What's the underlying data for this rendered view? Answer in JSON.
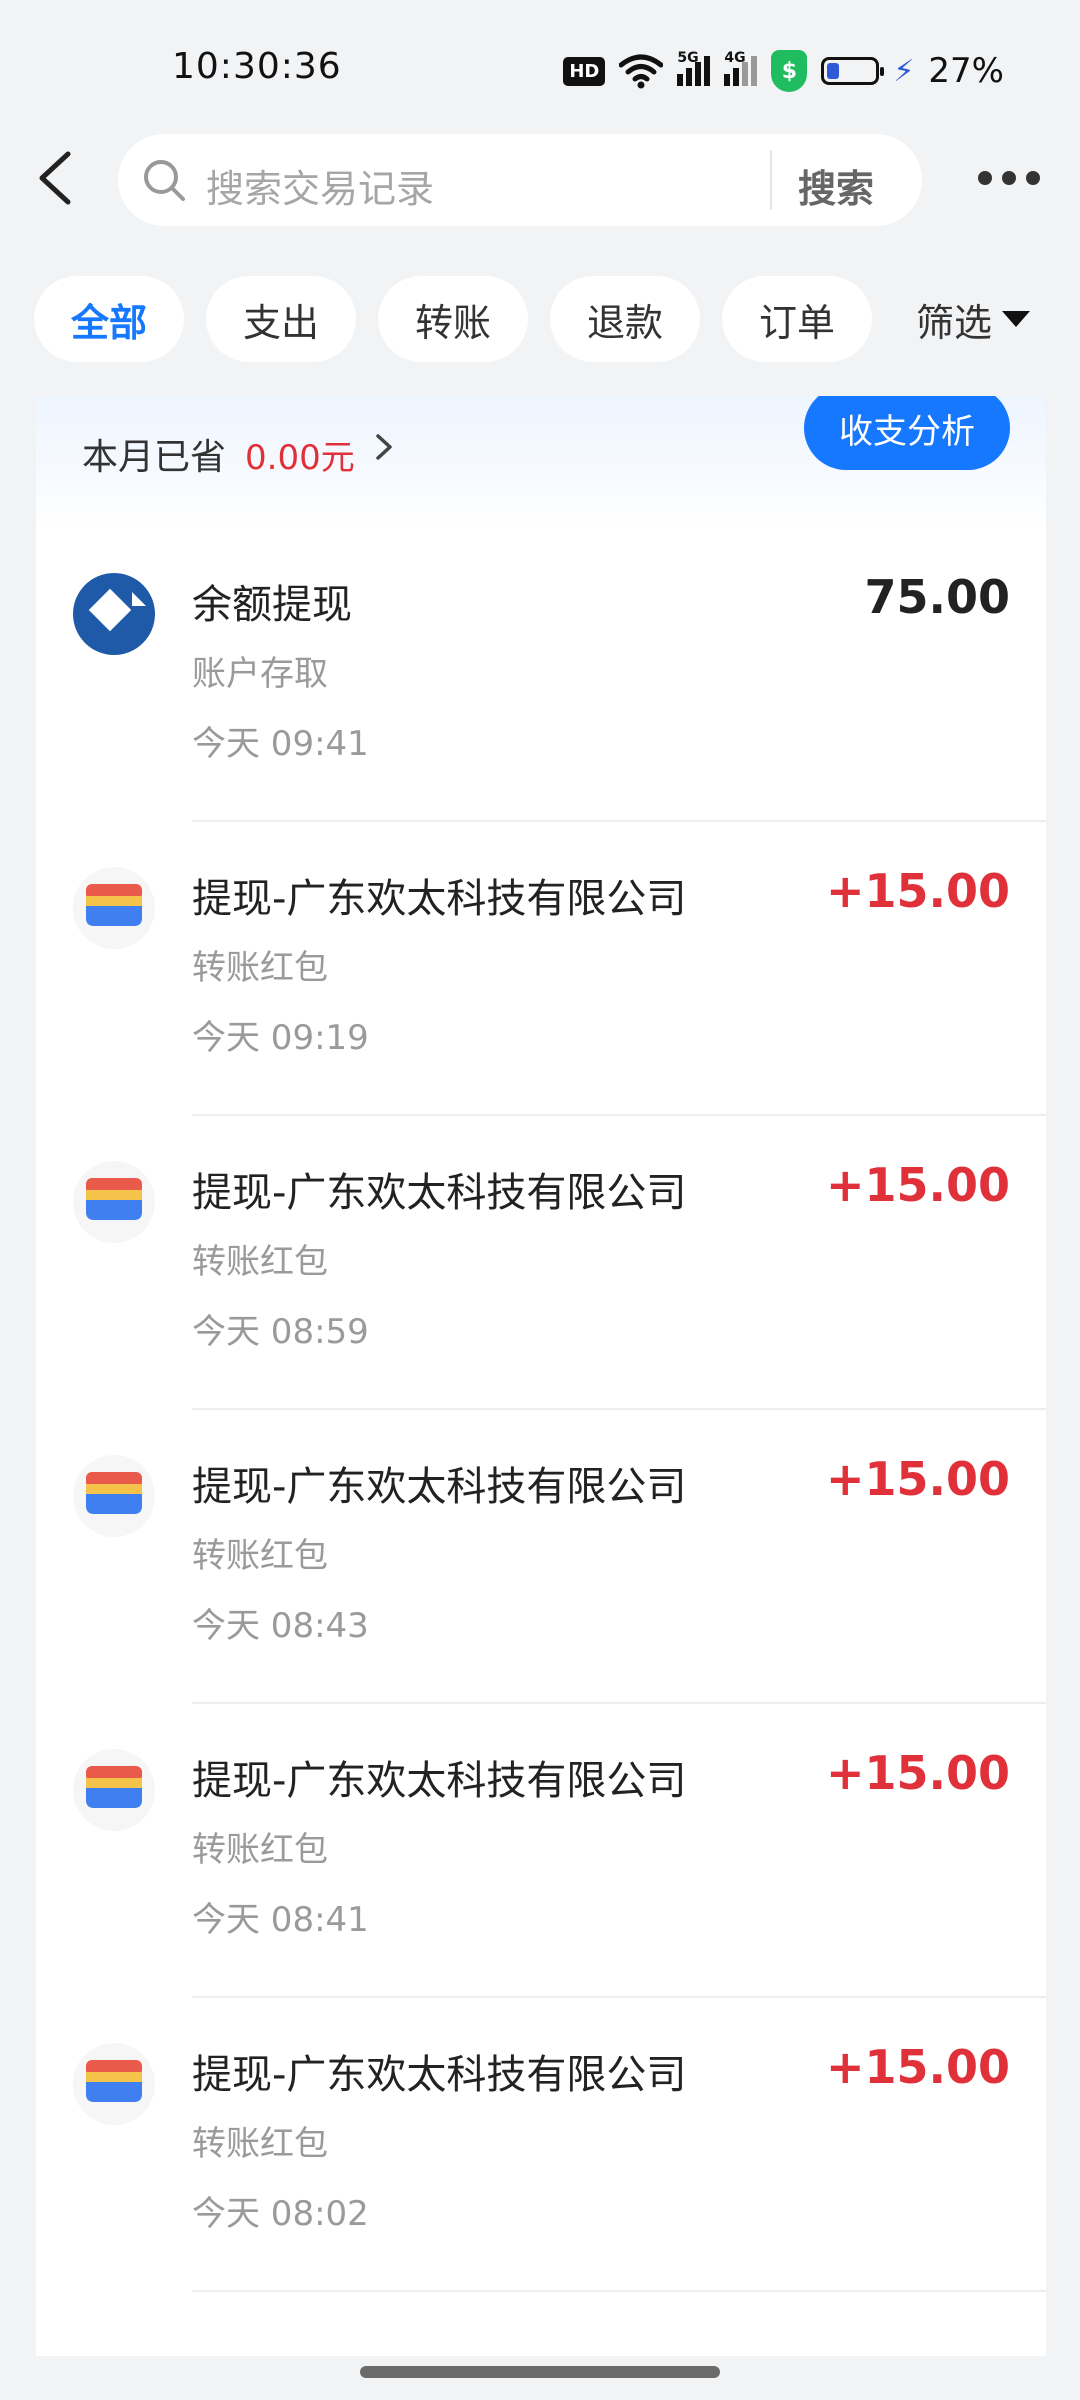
{
  "status_bar": {
    "time": "10:30:36",
    "hd_badge": "HD",
    "signal_1": "5G",
    "signal_2": "4G",
    "shield_glyph": "$",
    "battery_percent": "27%",
    "battery_level": 0.27
  },
  "header": {
    "search_placeholder": "搜索交易记录",
    "search_button": "搜索"
  },
  "tabs": [
    {
      "label": "全部",
      "active": true
    },
    {
      "label": "支出",
      "active": false
    },
    {
      "label": "转账",
      "active": false
    },
    {
      "label": "退款",
      "active": false
    },
    {
      "label": "订单",
      "active": false
    }
  ],
  "filter_label": "筛选",
  "summary": {
    "label": "本月已省",
    "value": "0.00元",
    "analysis_button": "收支分析"
  },
  "transactions": [
    {
      "title": "余额提现",
      "category": "账户存取",
      "time": "今天 09:41",
      "amount": "75.00",
      "type": "neutral",
      "icon": "bank-icon"
    },
    {
      "title": "提现-广东欢太科技有限公司",
      "category": "转账红包",
      "time": "今天 09:19",
      "amount": "+15.00",
      "type": "income",
      "icon": "wallet-icon"
    },
    {
      "title": "提现-广东欢太科技有限公司",
      "category": "转账红包",
      "time": "今天 08:59",
      "amount": "+15.00",
      "type": "income",
      "icon": "wallet-icon"
    },
    {
      "title": "提现-广东欢太科技有限公司",
      "category": "转账红包",
      "time": "今天 08:43",
      "amount": "+15.00",
      "type": "income",
      "icon": "wallet-icon"
    },
    {
      "title": "提现-广东欢太科技有限公司",
      "category": "转账红包",
      "time": "今天 08:41",
      "amount": "+15.00",
      "type": "income",
      "icon": "wallet-icon"
    },
    {
      "title": "提现-广东欢太科技有限公司",
      "category": "转账红包",
      "time": "今天 08:02",
      "amount": "+15.00",
      "type": "income",
      "icon": "wallet-icon"
    }
  ],
  "colors": {
    "accent": "#1677ff",
    "income": "#e0313a",
    "bank": "#1f5aa8"
  }
}
